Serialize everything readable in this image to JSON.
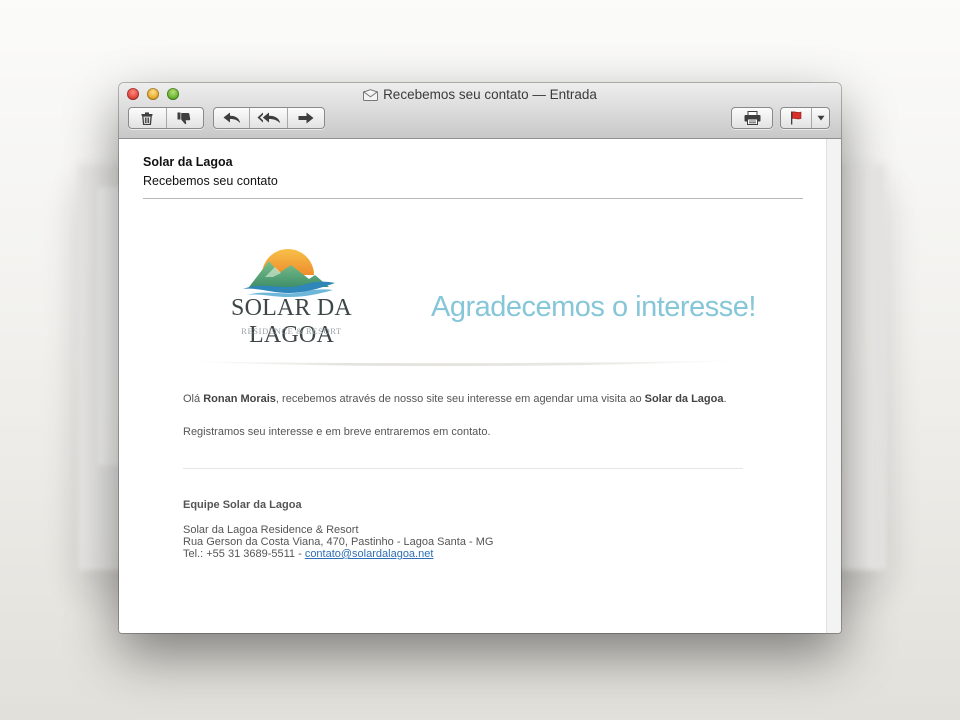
{
  "window": {
    "title": "Recebemos seu contato — Entrada",
    "title_icon": "envelope-icon"
  },
  "toolbar": {
    "groups": [
      {
        "name": "delete-junk",
        "buttons": [
          "trash-icon",
          "thumbs-down-icon"
        ]
      },
      {
        "name": "reply-forward",
        "buttons": [
          "reply-icon",
          "reply-all-icon",
          "forward-icon"
        ]
      },
      {
        "name": "print",
        "buttons": [
          "printer-icon"
        ]
      },
      {
        "name": "flag",
        "buttons": [
          "flag-icon",
          "chevron-down-icon"
        ]
      }
    ]
  },
  "message": {
    "from": "Solar da Lagoa",
    "subject": "Recebemos seu contato"
  },
  "email": {
    "logo_name": "SOLAR DA LAGOA",
    "logo_sub": "RESIDENCE & RESORT",
    "tagline": "Agradecemos o interesse!",
    "greeting_prefix": "Olá ",
    "customer_name": "Ronan Morais",
    "greeting_mid": ", recebemos através de nosso site seu interesse em agendar uma visita ao ",
    "venue": "Solar da Lagoa",
    "greeting_end": ".",
    "body_line2": "Registramos seu interesse e em breve entraremos em contato.",
    "team": "Equipe Solar da Lagoa",
    "address_line1": "Solar da Lagoa Residence & Resort",
    "address_line2": "Rua Gerson da Costa Viana, 470, Pastinho - Lagoa Santa - MG",
    "phone_prefix": "Tel.: +55 31 3689-5511 - ",
    "email_link": "contato@solardalagoa.net"
  },
  "colors": {
    "tagline": "#86c6d9",
    "link": "#2f6fb5",
    "sun": "#f2a83b",
    "mountain": "#5fa77d",
    "water": "#2f86b8"
  }
}
